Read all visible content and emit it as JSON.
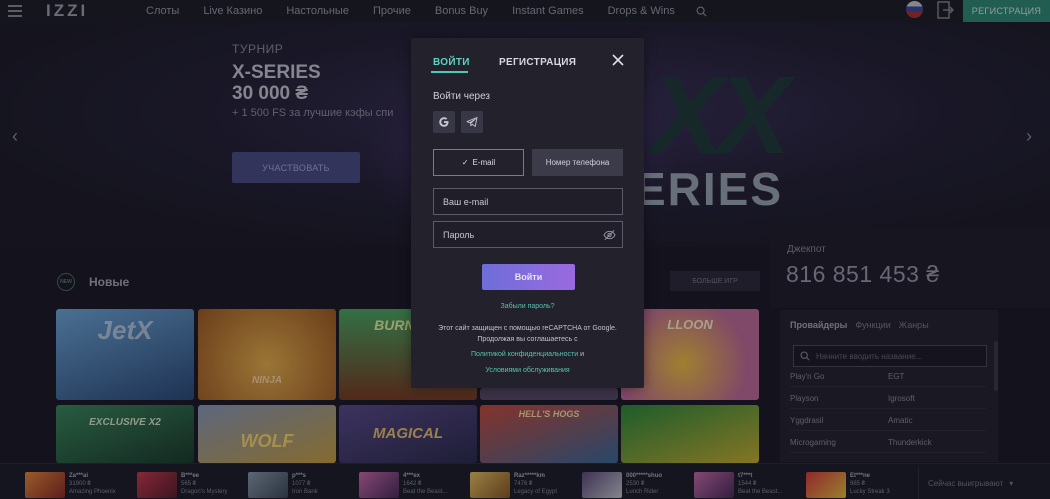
{
  "header": {
    "logo": "IZZI",
    "nav": [
      "Слоты",
      "Live Казино",
      "Настольные",
      "Прочие",
      "Bonus Buy",
      "Instant Games",
      "Drops & Wins"
    ],
    "register_label": "РЕГИСТРАЦИЯ"
  },
  "hero": {
    "tag": "ТУРНИР",
    "title_line1": "X-SERIES",
    "title_line2": "30 000 ₴",
    "subtitle": "+ 1 500 FS за лучшие кэфы спи",
    "cta": "УЧАСТВОВАТЬ",
    "art_title": "XX",
    "art_series": "ERIES"
  },
  "games_section": {
    "badge": "NEW",
    "title": "Новые",
    "more_label": "БОЛЬШЕ ИГР",
    "tiles": [
      {
        "label": "JetX"
      },
      {
        "label": "NINJA"
      },
      {
        "label": "BURN ICE"
      },
      {
        "label": ""
      },
      {
        "label": "LLOON"
      },
      {
        "label": "EXCLUSIVE X2"
      },
      {
        "label": "WOLF"
      },
      {
        "label": "MAGICAL"
      },
      {
        "label": "HELL'S HOGS"
      },
      {
        "label": ""
      }
    ]
  },
  "jackpot": {
    "label": "Джекпот",
    "value": "816 851 453 ₴"
  },
  "providers": {
    "tabs": [
      "Провайдеры",
      "Функции",
      "Жанры"
    ],
    "search_placeholder": "Начните вводить название...",
    "rows": [
      [
        "Play'n Go",
        "EGT"
      ],
      [
        "Playson",
        "Igrosoft"
      ],
      [
        "Yggdrasil",
        "Amatic"
      ],
      [
        "Microgaming",
        "Thunderkick"
      ]
    ]
  },
  "winners": {
    "items": [
      {
        "user": "Za***ai",
        "amount": "31900 ₴",
        "game": "Amazing Phoenix"
      },
      {
        "user": "B***ee",
        "amount": "565 ₴",
        "game": "Dragon's Mystery"
      },
      {
        "user": "p***s",
        "amount": "1077 ₴",
        "game": "Iron Bank"
      },
      {
        "user": "4***ex",
        "amount": "1642 ₴",
        "game": "Beat the Beast..."
      },
      {
        "user": "Raz*****km",
        "amount": "7476 ₴",
        "game": "Legacy of Egypt"
      },
      {
        "user": "000*****shuo",
        "amount": "2530 ₴",
        "game": "Lunch Rider"
      },
      {
        "user": "t7***t",
        "amount": "1544 ₴",
        "game": "Beat the Beast..."
      },
      {
        "user": "Et***ne",
        "amount": "985 ₴",
        "game": "Lucky Streak 3"
      }
    ],
    "now_winning": "Сейчас выигрывают"
  },
  "modal": {
    "tab_login": "ВОЙТИ",
    "tab_register": "РЕГИСТРАЦИЯ",
    "login_via": "Войти через",
    "method_email": "E-mail",
    "method_phone": "Номер телефона",
    "email_placeholder": "Ваш e-mail",
    "password_placeholder": "Пароль",
    "submit": "Войти",
    "forgot": "Забыли пароль?",
    "recaptcha_line1": "Этот сайт защищен с помощью reCAPTCHA от Google.",
    "recaptcha_line2": "Продолжая вы соглашаетесь с",
    "privacy_link": "Политикой конфиденциальности",
    "and": "и",
    "terms_link": "Условиями обслуживания"
  },
  "colors": {
    "accent": "#4fc7b5",
    "submit_gradient_start": "#6e6ed8",
    "submit_gradient_end": "#9a6ae0",
    "register_header": "#2e8a74"
  }
}
